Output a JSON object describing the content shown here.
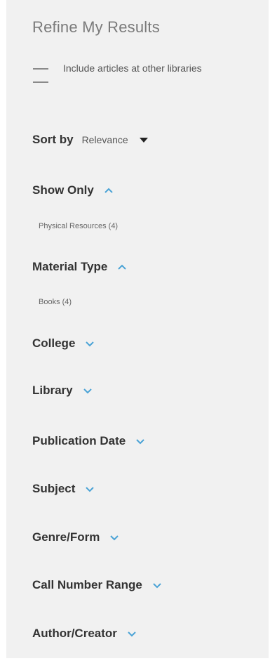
{
  "panel": {
    "title": "Refine My Results",
    "include_articles": "Include articles at other libraries",
    "sort": {
      "label": "Sort by",
      "value": "Relevance"
    },
    "facets": [
      {
        "label": "Show Only",
        "state": "expanded",
        "options": [
          "Physical Resources (4)"
        ]
      },
      {
        "label": "Material Type",
        "state": "expanded",
        "options": [
          "Books (4)"
        ]
      },
      {
        "label": "College",
        "state": "collapsed"
      },
      {
        "label": "Library",
        "state": "collapsed"
      },
      {
        "label": "Publication Date",
        "state": "collapsed"
      },
      {
        "label": "Subject",
        "state": "collapsed"
      },
      {
        "label": "Genre/Form",
        "state": "collapsed"
      },
      {
        "label": "Call Number Range",
        "state": "collapsed"
      },
      {
        "label": "Author/Creator",
        "state": "collapsed"
      }
    ]
  },
  "colors": {
    "panel_bg": "#f1f1f1",
    "accent_chevron": "#4aa3d6",
    "heading_text": "#333333"
  },
  "icons": {
    "expanded": "chevron-up-icon",
    "collapsed": "chevron-down-icon",
    "sort": "caret-down-icon"
  }
}
